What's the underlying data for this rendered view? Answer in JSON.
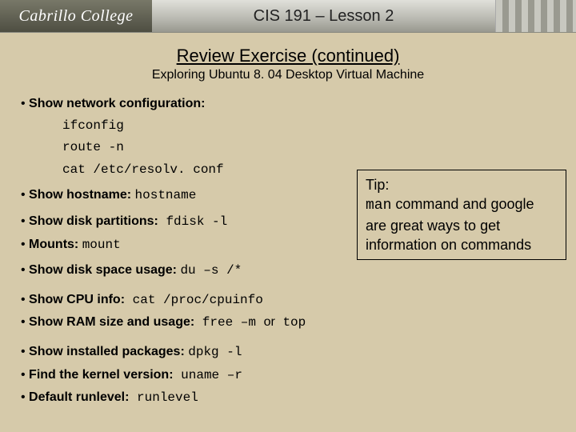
{
  "header": {
    "logo": "Cabrillo College",
    "course": "CIS 191 – Lesson 2"
  },
  "title": "Review Exercise (continued)",
  "subtitle": "Exploring Ubuntu 8. 04 Desktop Virtual Machine",
  "bullets": {
    "net": {
      "label": "Show network configuration:",
      "cmds": [
        "ifconfig",
        "route -n",
        "cat /etc/resolv. conf"
      ]
    },
    "host": {
      "label": "Show hostname:",
      "cmd": "hostname"
    },
    "part": {
      "label": "Show disk partitions:",
      "cmd": " fdisk -l"
    },
    "mount": {
      "label": "Mounts:",
      "cmd": "mount"
    },
    "du": {
      "label": "Show disk space usage:",
      "cmd": "du –s /*"
    },
    "cpu": {
      "label": "Show CPU info:",
      "cmd": " cat /proc/cpuinfo"
    },
    "ram": {
      "label": "Show RAM size and usage:",
      "cmd": " free –m ",
      "tail": "or",
      "cmd2": " top"
    },
    "pkg": {
      "label": "Show installed packages:",
      "cmd": "dpkg -l"
    },
    "kern": {
      "label": "Find the kernel version:",
      "cmd": " uname –r"
    },
    "run": {
      "label": "Default runlevel:",
      "cmd": " runlevel"
    }
  },
  "tip": {
    "heading": "Tip:",
    "l1a": "man",
    "l1b": " command and google are great ways to get information on commands"
  }
}
